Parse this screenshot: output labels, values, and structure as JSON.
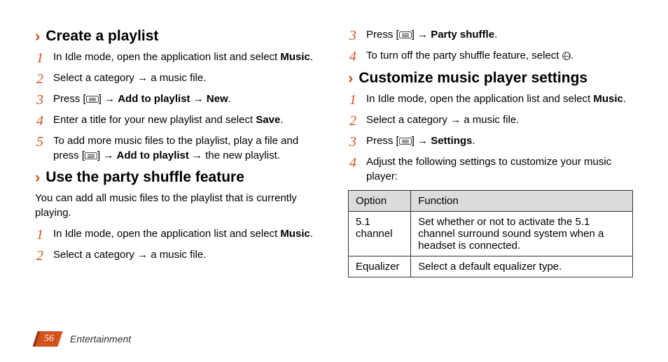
{
  "left": {
    "section1": {
      "title": "Create a playlist",
      "steps": [
        {
          "pre": "In Idle mode, open the application list and select ",
          "bold1": "Music",
          "post1": "."
        },
        {
          "text": "Select a category → a music file."
        },
        {
          "pre": "Press [",
          "icon": "menu",
          "mid": "] → ",
          "bold1": "Add to playlist",
          "mid2": " → ",
          "bold2": "New",
          "post": "."
        },
        {
          "pre": "Enter a title for your new playlist and select ",
          "bold1": "Save",
          "post1": "."
        },
        {
          "pre": "To add more music files to the playlist, play a file and press [",
          "icon": "menu",
          "mid": "] → ",
          "bold1": "Add to playlist",
          "post1": " → the new playlist."
        }
      ]
    },
    "section2": {
      "title": "Use the party shuffle feature",
      "sub": "You can add all music files to the playlist that is currently playing.",
      "steps": [
        {
          "pre": "In Idle mode, open the application list and select ",
          "bold1": "Music",
          "post1": "."
        },
        {
          "text": "Select a category → a music file."
        }
      ]
    }
  },
  "right": {
    "topsteps_startnum": 3,
    "topsteps": [
      {
        "pre": "Press [",
        "icon": "menu",
        "mid": "] → ",
        "bold1": "Party shuffle",
        "post1": "."
      },
      {
        "pre": "To turn off the party shuffle feature, select ",
        "icon": "globe",
        "post1": "."
      }
    ],
    "section1": {
      "title": "Customize music player settings",
      "steps": [
        {
          "pre": "In Idle mode, open the application list and select ",
          "bold1": "Music",
          "post1": "."
        },
        {
          "text": "Select a category → a music file."
        },
        {
          "pre": "Press [",
          "icon": "menu",
          "mid": "] → ",
          "bold1": "Settings",
          "post1": "."
        },
        {
          "text": "Adjust the following settings to customize your music player:"
        }
      ],
      "table": {
        "headers": [
          "Option",
          "Function"
        ],
        "rows": [
          [
            "5.1 channel",
            "Set whether or not to activate the 5.1 channel surround sound system when a headset is connected."
          ],
          [
            "Equalizer",
            "Select a default equalizer type."
          ]
        ]
      }
    }
  },
  "footer": {
    "page": "56",
    "label": "Entertainment"
  }
}
